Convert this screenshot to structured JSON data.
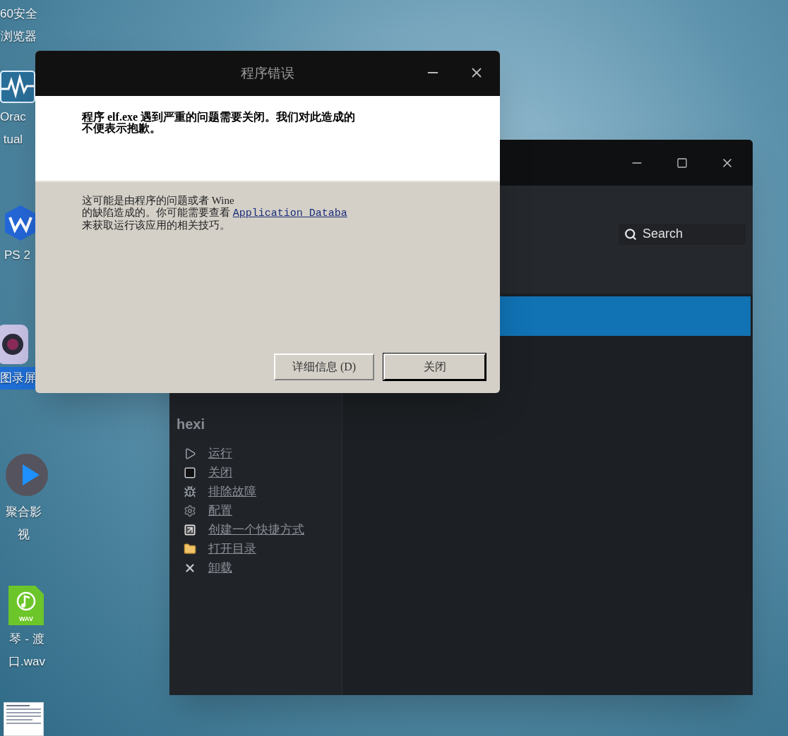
{
  "desktop_icons": [
    {
      "kind": "browser",
      "label": [
        "60安全",
        "浏览器"
      ]
    },
    {
      "kind": "wave",
      "label": [
        "Orac",
        "tual"
      ]
    },
    {
      "kind": "office",
      "label": [
        "PS 2"
      ]
    },
    {
      "kind": "camera",
      "label": [
        "图录屏"
      ]
    },
    {
      "kind": "player",
      "label": [
        "聚合影",
        "视"
      ]
    },
    {
      "kind": "audio",
      "badge": "WAV",
      "label": [
        "琴 - 渡",
        "口.wav"
      ]
    },
    {
      "kind": "document"
    }
  ],
  "app_window": {
    "search": {
      "placeholder": "Search"
    },
    "list_rows": [
      {
        "selected": true
      }
    ],
    "prefix_name": "hexi",
    "actions": [
      {
        "kind": "run",
        "label": "运行"
      },
      {
        "kind": "stop",
        "label": "关闭"
      },
      {
        "kind": "troubleshoot",
        "label": "排除故障"
      },
      {
        "kind": "configure",
        "label": "配置"
      },
      {
        "kind": "shortcut",
        "label": "创建一个快捷方式"
      },
      {
        "kind": "folder",
        "label": "打开目录"
      },
      {
        "kind": "uninstall",
        "label": "卸载"
      }
    ]
  },
  "dialog": {
    "title": "程序错误",
    "message": [
      "程序 elf.exe 遇到严重的问题需要关闭。我们对此造成的",
      "不便表示抱歉。"
    ],
    "details": {
      "before": "这可能是由程序的问题或者 Wine\n的缺陷造成的。你可能需要查看 ",
      "link": "Application Databa",
      "after": "\n来获取运行该应用的相关技巧。"
    },
    "buttons": [
      {
        "label": "详细信息 (D)",
        "default": false
      },
      {
        "label": "关闭",
        "default": true
      }
    ]
  }
}
